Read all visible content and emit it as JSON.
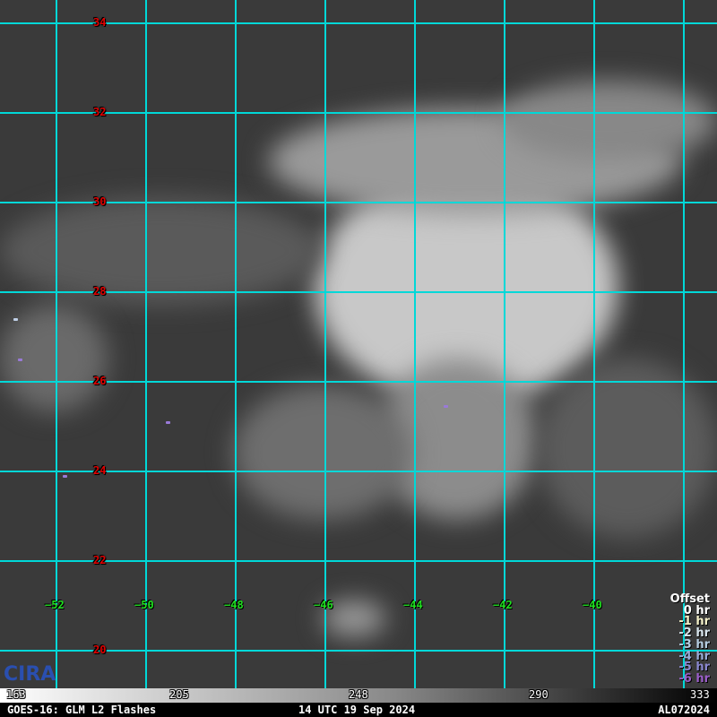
{
  "map": {
    "latitudes": [
      "34",
      "32",
      "30",
      "28",
      "26",
      "24",
      "22",
      "20"
    ],
    "longitudes": [
      "−52",
      "−50",
      "−48",
      "−46",
      "−44",
      "−42",
      "−40"
    ],
    "grid_color": "#00d8d8"
  },
  "legend": {
    "title": "Offset",
    "items": [
      {
        "label": "0 hr",
        "color": "#ffffff"
      },
      {
        "label": "-1 hr",
        "color": "#f4f0c8"
      },
      {
        "label": "-2 hr",
        "color": "#d8e4ec"
      },
      {
        "label": "-3 hr",
        "color": "#b4cce0"
      },
      {
        "label": "-4 hr",
        "color": "#98acd8"
      },
      {
        "label": "-5 hr",
        "color": "#8a88d0"
      },
      {
        "label": "-6 hr",
        "color": "#9a5ec8"
      }
    ]
  },
  "colorbar": {
    "ticks": [
      "163",
      "205",
      "248",
      "290",
      "333"
    ]
  },
  "footer": {
    "product": "GOES-16: GLM L2 Flashes",
    "time": "14 UTC 19 Sep 2024",
    "storm_id": "AL072024"
  },
  "logo": {
    "text": "CIRA"
  }
}
